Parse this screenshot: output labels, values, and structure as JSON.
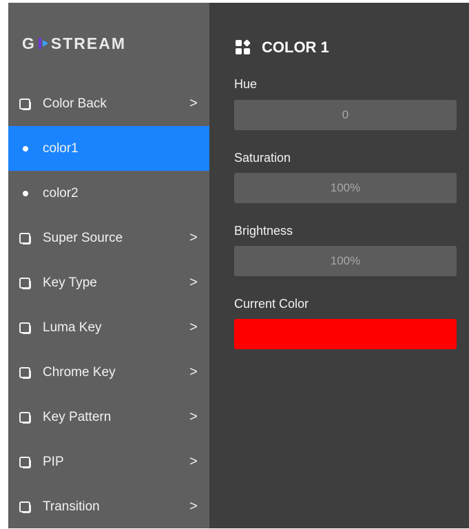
{
  "logo": {
    "text_left": "G",
    "text_right": "STREAM"
  },
  "sidebar": {
    "items": [
      {
        "label": "Color Back",
        "icon": "layers-icon",
        "has_chevron": true,
        "active": false
      },
      {
        "label": "color1",
        "icon": "dot-icon",
        "has_chevron": false,
        "active": true
      },
      {
        "label": "color2",
        "icon": "dot-icon",
        "has_chevron": false,
        "active": false
      },
      {
        "label": "Super Source",
        "icon": "layers-icon",
        "has_chevron": true,
        "active": false
      },
      {
        "label": "Key Type",
        "icon": "layers-icon",
        "has_chevron": true,
        "active": false
      },
      {
        "label": "Luma Key",
        "icon": "layers-icon",
        "has_chevron": true,
        "active": false
      },
      {
        "label": "Chrome Key",
        "icon": "layers-icon",
        "has_chevron": true,
        "active": false
      },
      {
        "label": "Key Pattern",
        "icon": "layers-icon",
        "has_chevron": true,
        "active": false
      },
      {
        "label": "PIP",
        "icon": "layers-icon",
        "has_chevron": true,
        "active": false
      },
      {
        "label": "Transition",
        "icon": "layers-icon",
        "has_chevron": true,
        "active": false
      }
    ],
    "chevron": ">"
  },
  "panel": {
    "title": "COLOR 1",
    "hue": {
      "label": "Hue",
      "value": "0"
    },
    "saturation": {
      "label": "Saturation",
      "value": "100%"
    },
    "brightness": {
      "label": "Brightness",
      "value": "100%"
    },
    "current_color": {
      "label": "Current Color",
      "color": "#ff0000"
    }
  },
  "colors": {
    "sidebar_bg": "#5f5f5f",
    "panel_bg": "#3e3e3e",
    "active_bg": "#1a84ff",
    "field_bg": "#5c5c5c"
  }
}
